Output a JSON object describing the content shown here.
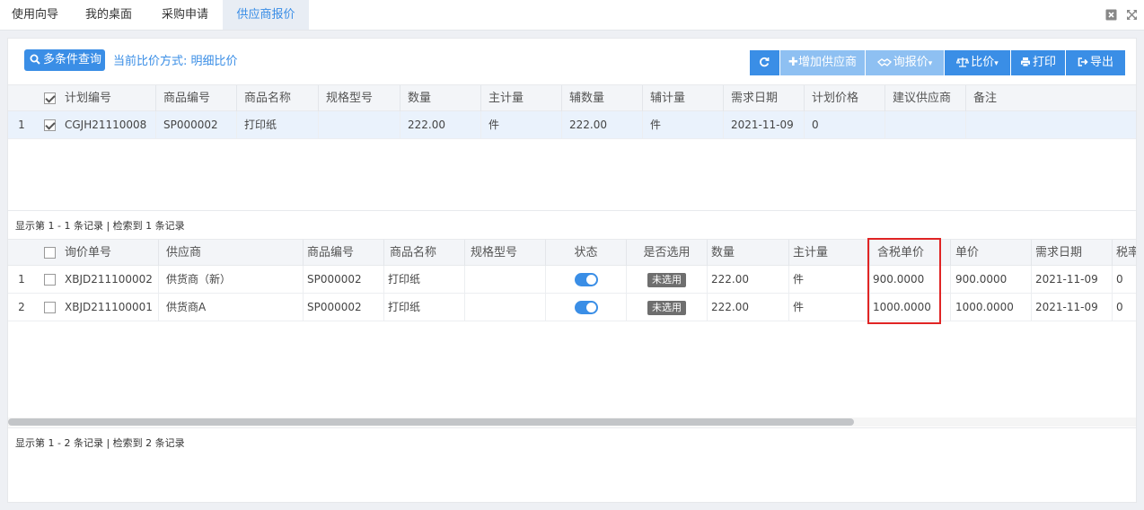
{
  "tabs": [
    {
      "label": "使用向导"
    },
    {
      "label": "我的桌面"
    },
    {
      "label": "采购申请"
    },
    {
      "label": "供应商报价"
    }
  ],
  "toolbar": {
    "search_label": "多条件查询",
    "mode_text": "当前比价方式: 明细比价",
    "add_supplier_label": "增加供应商",
    "inquiry_label": "询报价",
    "compare_label": "比价",
    "print_label": "打印",
    "export_label": "导出"
  },
  "plan_grid": {
    "headers": [
      "计划编号",
      "商品编号",
      "商品名称",
      "规格型号",
      "数量",
      "主计量",
      "辅数量",
      "辅计量",
      "需求日期",
      "计划价格",
      "建议供应商",
      "备注"
    ],
    "rows": [
      {
        "num": "1",
        "plan_no": "CGJH21110008",
        "goods_no": "SP000002",
        "goods_name": "打印纸",
        "spec": "",
        "qty": "222.00",
        "unit": "件",
        "aux_qty": "222.00",
        "aux_unit": "件",
        "date": "2021-11-09",
        "plan_price": "0",
        "supplier": "",
        "note": ""
      }
    ],
    "pager": "显示第 1 - 1 条记录 | 检索到 1 条记录"
  },
  "quote_grid": {
    "headers": [
      "询价单号",
      "供应商",
      "商品编号",
      "商品名称",
      "规格型号",
      "状态",
      "是否选用",
      "数量",
      "主计量",
      "含税单价",
      "单价",
      "需求日期",
      "税率"
    ],
    "rows": [
      {
        "num": "1",
        "quote_no": "XBJD211100002",
        "supplier": "供货商（新）",
        "goods_no": "SP000002",
        "goods_name": "打印纸",
        "spec": "",
        "selected": "未选用",
        "qty": "222.00",
        "unit": "件",
        "tax_price": "900.0000",
        "price": "900.0000",
        "date": "2021-11-09",
        "tax_rate": "0"
      },
      {
        "num": "2",
        "quote_no": "XBJD211100001",
        "supplier": "供货商A",
        "goods_no": "SP000002",
        "goods_name": "打印纸",
        "spec": "",
        "selected": "未选用",
        "qty": "222.00",
        "unit": "件",
        "tax_price": "1000.0000",
        "price": "1000.0000",
        "date": "2021-11-09",
        "tax_rate": "0"
      }
    ],
    "pager": "显示第 1 - 2 条记录 | 检索到 2 条记录"
  },
  "colors": {
    "accent": "#3a8ee6",
    "highlight": "#e02424"
  }
}
